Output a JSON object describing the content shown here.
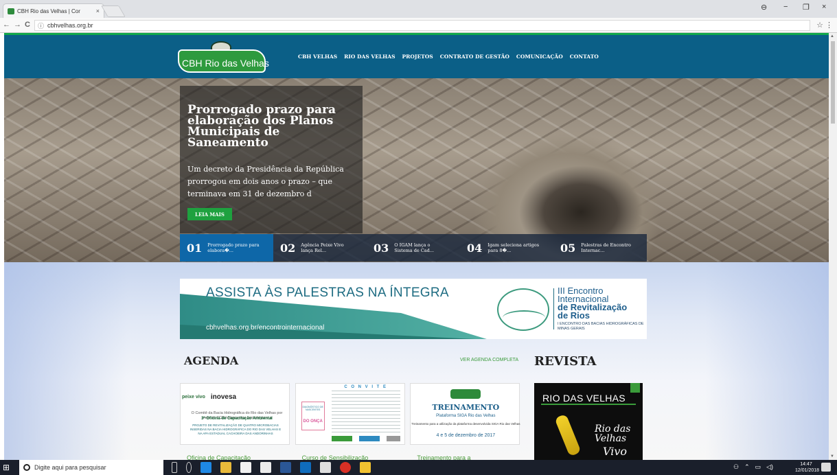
{
  "browser": {
    "tab_title": "CBH Rio das Velhas | Cor",
    "tab_close": "×",
    "url": "cbhvelhas.org.br",
    "back": "←",
    "forward": "→",
    "reload": "C",
    "info": "ⓘ",
    "star": "☆",
    "menu": "⋮",
    "window": {
      "account": "⊖",
      "minimize": "−",
      "maximize": "❐",
      "close": "×"
    }
  },
  "site": {
    "logo_text": "CBH Rio das Velhas",
    "nav": [
      "CBH VELHAS",
      "RIO DAS VELHAS",
      "PROJETOS",
      "CONTRATO DE GESTÃO",
      "COMUNICAÇÃO",
      "CONTATO"
    ]
  },
  "hero": {
    "title": "Prorrogado prazo para elaboração dos Planos Municipais de Saneamento",
    "text": "Um decreto da Presidência da República prorrogou em dois anos o prazo – que terminava em 31 de dezembro d",
    "button": "LEIA MAIS",
    "slides": [
      {
        "num": "01",
        "text": "Prorrogado prazo para elabora�..."
      },
      {
        "num": "02",
        "text": "Agência Peixe Vivo lança Rel..."
      },
      {
        "num": "03",
        "text": "O IGAM lança o Sistema de Cad..."
      },
      {
        "num": "04",
        "text": "Igam seleciona artigos para 8�..."
      },
      {
        "num": "05",
        "text": "Palestras de Encontro Internac..."
      }
    ]
  },
  "banner": {
    "headline": "ASSISTA ÀS PALESTRAS NA ÍNTEGRA",
    "url": "cbhvelhas.org.br/encontrointernacional",
    "event_l1": "III Encontro",
    "event_l2": "Internacional",
    "event_l3": "de Revitalização",
    "event_l4": "de Rios",
    "event_l5": "I ENCONTRO DAS BACIAS HIDROGRÁFICAS DE MINAS GERAIS"
  },
  "agenda": {
    "heading": "AGENDA",
    "link": "VER AGENDA COMPLETA",
    "cards": [
      {
        "title": "Oficina de Capacitação",
        "logo_a": "peixe vivo",
        "logo_b": "inovesa",
        "line1": "O Comitê da Bacia Hidrográfica do Rio das Velhas por meio do SCBH Nascentes convida para a",
        "line2": "3ª Oficina de Capacitação Ambiental",
        "line3": "PROJETO DE REVITALIZAÇÃO DE QUATRO MICROBACIAS INSERIDAS NA BACIA HIDROGRÁFICA DO RIO DAS VELHAS E NA APA ESTADUAL CACHOEIRA DAS ANDORINHAS"
      },
      {
        "title": "Curso de Sensibilização",
        "head": "C O N V I T E",
        "box_top": "DIAGNÓSTICO DE NASCENTES",
        "box_bottom": "DO ONÇA"
      },
      {
        "title": "Treinamento para a",
        "t1": "TREINAMENTO",
        "t2": "Plataforma SIGA Rio das Velhas",
        "t3": "Treinamento para a utilização da plataforma desenvolvida SIGA Rio das Velhas",
        "t4": "4 e 5 de dezembro de 2017"
      }
    ]
  },
  "revista": {
    "heading": "REVISTA",
    "cover_title": "RIO DAS VELHAS",
    "cover_script1": "Rio das Velhas",
    "cover_script2": "Vivo"
  },
  "taskbar": {
    "search_placeholder": "Digite aqui para pesquisar",
    "time": "14:47",
    "date": "12/01/2018"
  },
  "colors": {
    "header_bg": "#0b5f87",
    "accent_green": "#1ea13f",
    "active_slide": "#0e67a8"
  }
}
